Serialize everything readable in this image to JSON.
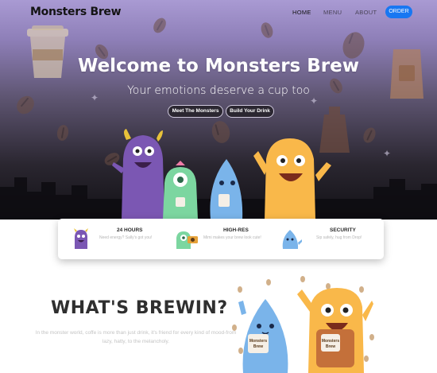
{
  "nav": {
    "logo": "Monsters Brew",
    "links": [
      "HOME",
      "MENU",
      "ABOUT"
    ],
    "order": "ORDER"
  },
  "hero": {
    "title": "Welcome to Monsters Brew",
    "subtitle": "Your emotions deserve a cup too",
    "buttons": [
      "Meet The Monsters",
      "Build Your Drink"
    ]
  },
  "features": [
    {
      "title": "24 HOURS",
      "text": "Need energy? Sally's got you!",
      "icon": "purple-monster-icon"
    },
    {
      "title": "HIGH-RES",
      "text": "Mimi makes your brew look cute!",
      "icon": "green-monster-camera-icon"
    },
    {
      "title": "SECURITY",
      "text": "Sip safely, hug from Drop!",
      "icon": "blue-monster-icon"
    }
  ],
  "brewin": {
    "title": "WHAT'S BREWIN?",
    "text": "In the monster world, coffe is more than just drink, it's friend for every kind of mood-from lazy, hatty, to the melancholy.",
    "cup_label_left": "Monsters Brew",
    "cup_label_right": "Monsters Brew"
  },
  "colors": {
    "accent": "#1877f2",
    "hero_top": "#a99ad3",
    "hero_bottom": "#121115"
  }
}
